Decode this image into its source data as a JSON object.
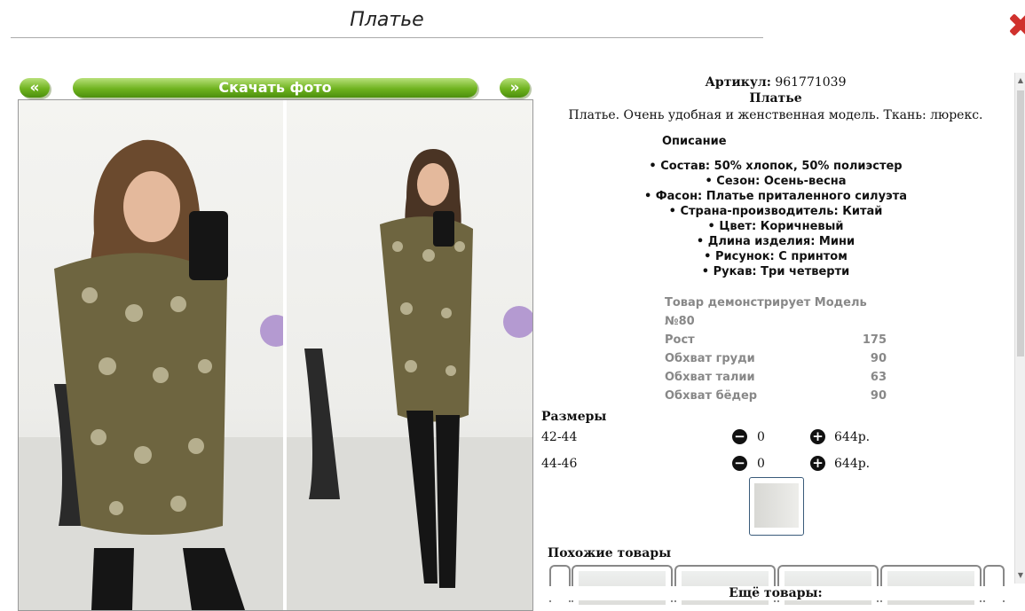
{
  "header": {
    "title": "Платье"
  },
  "nav": {
    "prev": "«",
    "next": "»",
    "download": "Скачать фото"
  },
  "product": {
    "article_label": "Артикул:",
    "article": "961771039",
    "name": "Платье",
    "description": "Платье. Очень удобная и женственная модель. Ткань: люрекс.",
    "desc_heading": "Описание",
    "specs": [
      "• Состав: 50% хлопок, 50% полиэстер",
      "• Сезон: Осень-весна",
      "• Фасон: Платье приталенного силуэта",
      "• Страна-производитель: Китай",
      "• Цвет: Коричневый",
      "• Длина изделия: Мини",
      "• Рисунок: С принтом",
      "• Рукав: Три четверти"
    ],
    "model": [
      {
        "label": "Товар демонстрирует Модель №80",
        "value": ""
      },
      {
        "label": "Рост",
        "value": "175"
      },
      {
        "label": "Обхват груди",
        "value": "90"
      },
      {
        "label": "Обхват талии",
        "value": "63"
      },
      {
        "label": "Обхват бёдер",
        "value": "90"
      }
    ],
    "sizes_heading": "Размеры",
    "sizes": [
      {
        "size": "42-44",
        "qty": "0",
        "price": "644р."
      },
      {
        "size": "44-46",
        "qty": "0",
        "price": "644р."
      }
    ],
    "similar_heading": "Похожие товары",
    "more_heading": "Ещё товары:"
  },
  "icons": {
    "minus": "minus-circle-icon",
    "plus": "plus-circle-icon",
    "close": "close-icon"
  },
  "colors": {
    "accent_green": "#6fb31f",
    "close_red": "#d0312d"
  }
}
